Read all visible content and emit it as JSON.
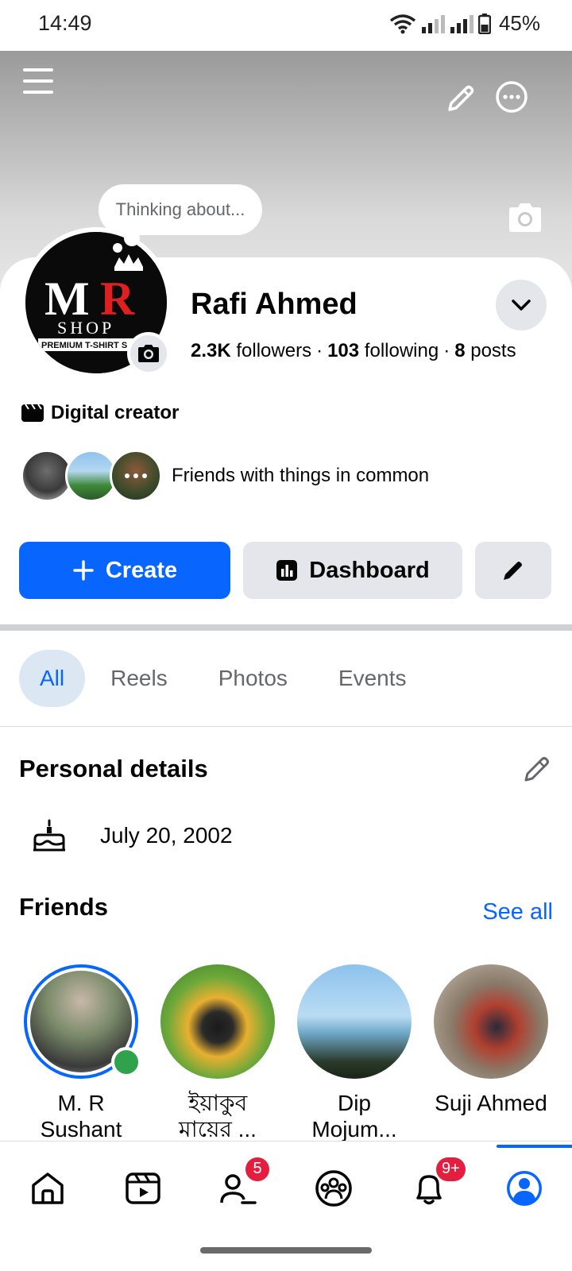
{
  "status_bar": {
    "time": "14:49",
    "battery": "45%"
  },
  "profile": {
    "thought_bubble": "Thinking about...",
    "name": "Rafi Ahmed",
    "followers_count": "2.3K",
    "followers_label": "followers",
    "following_count": "103",
    "following_label": "following",
    "posts_count": "8",
    "posts_label": "posts",
    "avatar_logo": {
      "line1": "MR",
      "line2": "SHOP",
      "line3": "PREMIUM T-SHIRT S"
    },
    "category": "Digital creator",
    "mutuals_text": "Friends with things in common"
  },
  "actions": {
    "create_label": "Create",
    "dashboard_label": "Dashboard"
  },
  "tabs": [
    {
      "label": "All",
      "active": true
    },
    {
      "label": "Reels",
      "active": false
    },
    {
      "label": "Photos",
      "active": false
    },
    {
      "label": "Events",
      "active": false
    }
  ],
  "personal_details": {
    "title": "Personal details",
    "birthday": "July 20, 2002"
  },
  "friends": {
    "title": "Friends",
    "see_all": "See all",
    "items": [
      {
        "name": "M. R Sushant",
        "online": true,
        "has_story": true
      },
      {
        "name": "ইয়াকুব মায়ের ...",
        "online": false,
        "has_story": false
      },
      {
        "name": "Dip Mojum...",
        "online": false,
        "has_story": false
      },
      {
        "name": "Suji Ahmed",
        "online": false,
        "has_story": false
      }
    ]
  },
  "bottom_nav": {
    "friends_badge": "5",
    "notifications_badge": "9+"
  },
  "colors": {
    "accent": "#0866ff",
    "badge": "#e41e3f",
    "online": "#31a24c"
  }
}
